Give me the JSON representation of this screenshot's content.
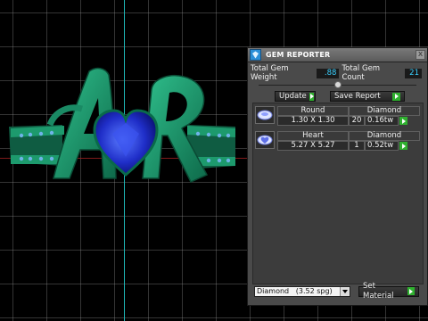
{
  "panel": {
    "title": "GEM REPORTER",
    "close_label": "x",
    "total_gem_weight_label": "Total Gem Weight",
    "total_gem_weight_value": ".88",
    "total_gem_count_label": "Total Gem Count",
    "total_gem_count_value": "21",
    "slider_level": 0.5,
    "update_label": "Update",
    "save_report_label": "Save Report"
  },
  "gems": [
    {
      "shape": "Round",
      "material": "Diamond",
      "size": "1.30 X 1.30",
      "count": "20",
      "weight": "0.16tw"
    },
    {
      "shape": "Heart",
      "material": "Diamond",
      "size": "5.27 X 5.27",
      "count": "1",
      "weight": "0.52tw"
    }
  ],
  "material_select": {
    "value": "Diamond   (3.52 spg)"
  },
  "set_material_label": "Set Material",
  "colors": {
    "ring_green": "#1a8a64",
    "heart_blue": "#2233cc",
    "accent_cyan": "#3ad0ff",
    "play_green": "#2fb02f"
  },
  "icons": {
    "tb_icon": "gem-reporter-icon",
    "round_gem": "round-gem-icon",
    "heart_gem": "heart-gem-icon"
  }
}
